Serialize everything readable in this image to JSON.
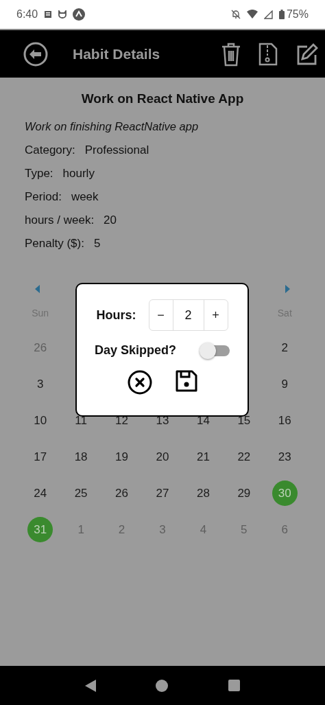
{
  "status_bar": {
    "time": "6:40",
    "battery": "75%"
  },
  "header": {
    "title": "Habit Details"
  },
  "habit": {
    "name": "Work on React Native App",
    "description": "Work on finishing ReactNative app",
    "details": [
      {
        "label": "Category:",
        "value": "Professional"
      },
      {
        "label": "Type:",
        "value": "hourly"
      },
      {
        "label": "Period:",
        "value": "week"
      },
      {
        "label": "hours / week:",
        "value": "20"
      },
      {
        "label": "Penalty ($):",
        "value": "5"
      }
    ]
  },
  "calendar": {
    "weekdays": {
      "sun": "Sun",
      "sat": "Sat"
    },
    "weeks": [
      {
        "sun": {
          "date": "26",
          "outside": true,
          "marked": false
        },
        "sat": {
          "date": "2",
          "outside": false,
          "marked": false
        }
      },
      {
        "sun": {
          "date": "3",
          "outside": false,
          "marked": false
        },
        "sat": {
          "date": "9",
          "outside": false,
          "marked": false
        }
      },
      {
        "sun": {
          "date": "10",
          "outside": false,
          "marked": false
        },
        "mon": {
          "date": "11",
          "outside": false,
          "marked": false
        },
        "tue": {
          "date": "12",
          "outside": false,
          "marked": false
        },
        "wed": {
          "date": "13",
          "outside": false,
          "marked": false
        },
        "thu": {
          "date": "14",
          "outside": false,
          "marked": false
        },
        "fri": {
          "date": "15",
          "outside": false,
          "marked": false
        },
        "sat": {
          "date": "16",
          "outside": false,
          "marked": false
        }
      },
      {
        "sun": {
          "date": "17",
          "outside": false,
          "marked": false
        },
        "mon": {
          "date": "18",
          "outside": false,
          "marked": false
        },
        "tue": {
          "date": "19",
          "outside": false,
          "marked": false
        },
        "wed": {
          "date": "20",
          "outside": false,
          "marked": false
        },
        "thu": {
          "date": "21",
          "outside": false,
          "marked": false
        },
        "fri": {
          "date": "22",
          "outside": false,
          "marked": false
        },
        "sat": {
          "date": "23",
          "outside": false,
          "marked": false
        }
      },
      {
        "sun": {
          "date": "24",
          "outside": false,
          "marked": false
        },
        "mon": {
          "date": "25",
          "outside": false,
          "marked": false
        },
        "tue": {
          "date": "26",
          "outside": false,
          "marked": false
        },
        "wed": {
          "date": "27",
          "outside": false,
          "marked": false
        },
        "thu": {
          "date": "28",
          "outside": false,
          "marked": false
        },
        "fri": {
          "date": "29",
          "outside": false,
          "marked": false
        },
        "sat": {
          "date": "30",
          "outside": false,
          "marked": true
        }
      },
      {
        "sun": {
          "date": "31",
          "outside": false,
          "marked": true
        },
        "mon": {
          "date": "1",
          "outside": true,
          "marked": false
        },
        "tue": {
          "date": "2",
          "outside": true,
          "marked": false
        },
        "wed": {
          "date": "3",
          "outside": true,
          "marked": false
        },
        "thu": {
          "date": "4",
          "outside": true,
          "marked": false
        },
        "fri": {
          "date": "5",
          "outside": true,
          "marked": false
        },
        "sat": {
          "date": "6",
          "outside": true,
          "marked": false
        }
      }
    ]
  },
  "dialog": {
    "hours_label": "Hours:",
    "minus": "−",
    "hours_value": "2",
    "plus": "+",
    "skip_label": "Day Skipped?",
    "skipped": false
  }
}
